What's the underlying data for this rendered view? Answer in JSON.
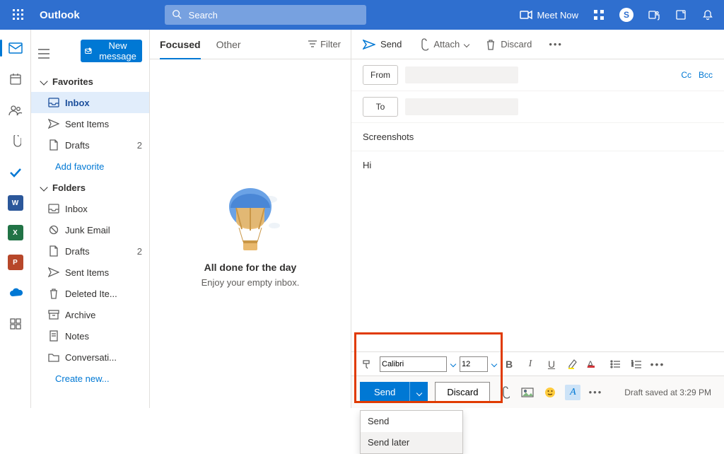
{
  "header": {
    "app_title": "Outlook",
    "search_placeholder": "Search",
    "meet_now": "Meet Now"
  },
  "rail_apps": {
    "word": {
      "label": "W",
      "color": "#2b579a"
    },
    "excel": {
      "label": "X",
      "color": "#217346"
    },
    "powerpoint": {
      "label": "P",
      "color": "#b7472a"
    },
    "onedrive": {
      "color": "#0078d4"
    }
  },
  "nav": {
    "new_message": "New message",
    "favorites": "Favorites",
    "fav_items": [
      {
        "label": "Inbox",
        "icon": "inbox",
        "selected": true
      },
      {
        "label": "Sent Items",
        "icon": "sent"
      },
      {
        "label": "Drafts",
        "icon": "draft",
        "count": "2"
      }
    ],
    "add_favorite": "Add favorite",
    "folders": "Folders",
    "folder_items": [
      {
        "label": "Inbox",
        "icon": "inbox"
      },
      {
        "label": "Junk Email",
        "icon": "junk"
      },
      {
        "label": "Drafts",
        "icon": "draft",
        "count": "2"
      },
      {
        "label": "Sent Items",
        "icon": "sent"
      },
      {
        "label": "Deleted Ite...",
        "icon": "trash"
      },
      {
        "label": "Archive",
        "icon": "archive"
      },
      {
        "label": "Notes",
        "icon": "notes"
      },
      {
        "label": "Conversati...",
        "icon": "folder"
      }
    ],
    "create_new": "Create new..."
  },
  "list": {
    "tabs": {
      "focused": "Focused",
      "other": "Other"
    },
    "filter": "Filter",
    "empty_title": "All done for the day",
    "empty_sub": "Enjoy your empty inbox."
  },
  "cmd": {
    "send": "Send",
    "attach": "Attach",
    "discard": "Discard"
  },
  "compose": {
    "from": "From",
    "to": "To",
    "cc": "Cc",
    "bcc": "Bcc",
    "subject": "Screenshots",
    "body": "Hi",
    "font": "Calibri",
    "size": "12"
  },
  "actions": {
    "send": "Send",
    "discard": "Discard",
    "menu": {
      "send": "Send",
      "send_later": "Send later"
    },
    "saved": "Draft saved at 3:29 PM"
  }
}
